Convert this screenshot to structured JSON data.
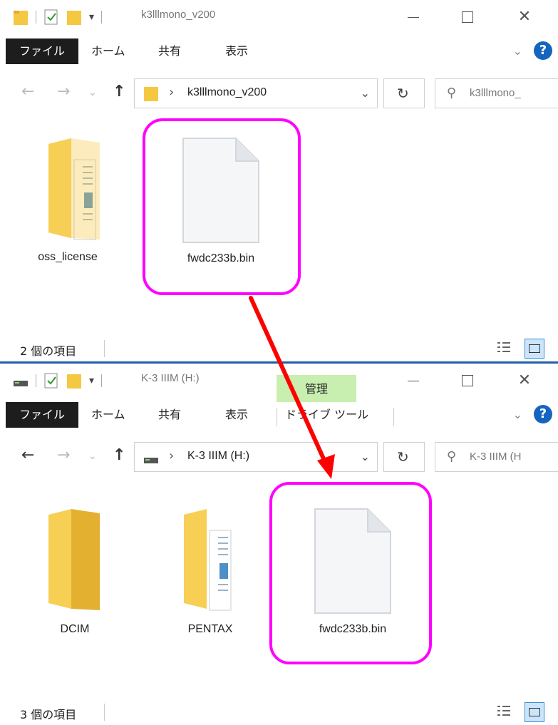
{
  "window1": {
    "title": "k3lllmono_v200",
    "tabs": {
      "file": "ファイル",
      "home": "ホーム",
      "share": "共有",
      "view": "表示"
    },
    "address": "k3lllmono_v200",
    "search_placeholder": "k3lllmono_",
    "items": [
      {
        "label": "oss_license",
        "icon": "folder-with-documents"
      },
      {
        "label": "fwdc233b.bin",
        "icon": "blank-file"
      }
    ],
    "status": "2 個の項目"
  },
  "window2": {
    "title": "K-3 IIIM (H:)",
    "context_tab": "管理",
    "tabs": {
      "file": "ファイル",
      "home": "ホーム",
      "share": "共有",
      "view": "表示",
      "drive_tools": "ドライブ ツール"
    },
    "address": "K-3 IIIM (H:)",
    "search_placeholder": "K-3 IIIM (H",
    "items": [
      {
        "label": "DCIM",
        "icon": "folder"
      },
      {
        "label": "PENTAX",
        "icon": "folder-with-documents"
      },
      {
        "label": "fwdc233b.bin",
        "icon": "blank-file"
      }
    ],
    "status": "3 個の項目"
  },
  "colors": {
    "highlight": "#ff00ff",
    "arrow": "#ff0000",
    "help_blue": "#1565c0",
    "folder_yellow": "#f5c842",
    "manage_green": "#c8eeb0"
  }
}
